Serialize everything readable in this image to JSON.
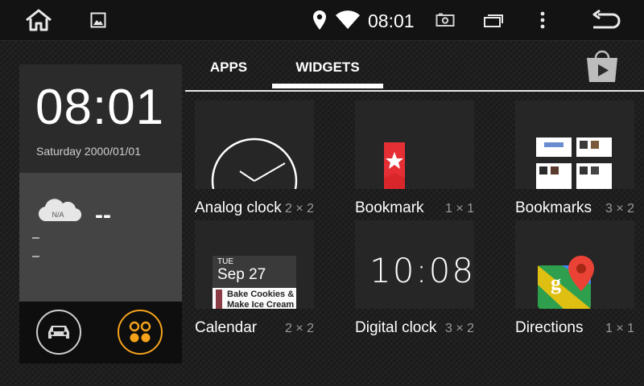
{
  "status_bar": {
    "time": "08:01",
    "icons": [
      "home-icon",
      "gallery-icon",
      "location-icon",
      "wifi-icon",
      "screenshot-icon",
      "recents-icon",
      "overflow-menu-icon",
      "back-icon"
    ]
  },
  "clock_widget": {
    "time": "08:01",
    "date": "Saturday 2000/01/01"
  },
  "weather_widget": {
    "badge": "N/A",
    "temperature": "--",
    "line1": "–",
    "line2": "–"
  },
  "shortcuts": [
    "car-icon",
    "apps-icon"
  ],
  "tabs": [
    {
      "label": "APPS",
      "selected": false
    },
    {
      "label": "WIDGETS",
      "selected": true
    }
  ],
  "widgets": [
    {
      "name": "Analog clock",
      "size": "2 × 2"
    },
    {
      "name": "Bookmark",
      "size": "1 × 1"
    },
    {
      "name": "Bookmarks",
      "size": "3 × 2"
    },
    {
      "name": "Calendar",
      "size": "2 × 2"
    },
    {
      "name": "Digital clock",
      "size": "3 × 2"
    },
    {
      "name": "Directions",
      "size": "1 × 1"
    }
  ],
  "calendar_preview": {
    "day_of_week": "TUE",
    "date": "Sep 27",
    "events": [
      "Bake Cookies &",
      "Make Ice Cream"
    ]
  },
  "digital_clock_preview": {
    "time": "10:08"
  },
  "colors": {
    "accent_orange": "#f5a21b",
    "bookmark_red": "#d9262b",
    "status_bar_bg": "#131313"
  }
}
